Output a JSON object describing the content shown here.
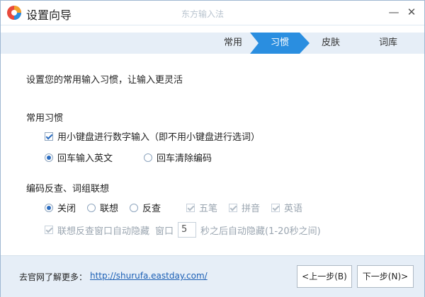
{
  "window": {
    "title": "设置向导",
    "subtitle": "东方输入法",
    "minimize_icon": "minimize-icon",
    "close_icon": "close-icon",
    "minimize_glyph": "—",
    "close_glyph": "✕"
  },
  "steps": [
    {
      "label": "常用",
      "active": false
    },
    {
      "label": "习惯",
      "active": true
    },
    {
      "label": "皮肤",
      "active": false
    },
    {
      "label": "词库",
      "active": false
    }
  ],
  "content": {
    "heading": "设置您的常用输入习惯，让输入更灵活",
    "habits": {
      "title": "常用习惯",
      "numpad_checkbox": {
        "label": "用小键盘进行数字输入（即不用小键盘进行选词）",
        "checked": true
      },
      "enter_options": [
        {
          "label": "回车输入英文",
          "checked": true
        },
        {
          "label": "回车清除编码",
          "checked": false
        }
      ]
    },
    "reverse": {
      "title": "编码反查、词组联想",
      "mode_options": [
        {
          "label": "关闭",
          "checked": true
        },
        {
          "label": "联想",
          "checked": false
        },
        {
          "label": "反查",
          "checked": false
        }
      ],
      "lookup_options": [
        {
          "label": "五笔",
          "checked": true,
          "disabled": true
        },
        {
          "label": "拼音",
          "checked": true,
          "disabled": true
        },
        {
          "label": "英语",
          "checked": true,
          "disabled": true
        }
      ],
      "auto_hide": {
        "label": "联想反查窗口自动隐藏",
        "window_label": "窗口",
        "seconds_value": "5",
        "suffix": "秒之后自动隐藏(1-20秒之间)",
        "checked": true,
        "disabled": true
      }
    }
  },
  "footer": {
    "label": "去官网了解更多：",
    "link": "http://shurufa.eastday.com/",
    "prev_button": "<上一步(B)",
    "next_button": "下一步(N)>"
  },
  "colors": {
    "accent": "#2a8ee0",
    "step_bar": "#e6eef7",
    "link": "#1b5fb5"
  }
}
